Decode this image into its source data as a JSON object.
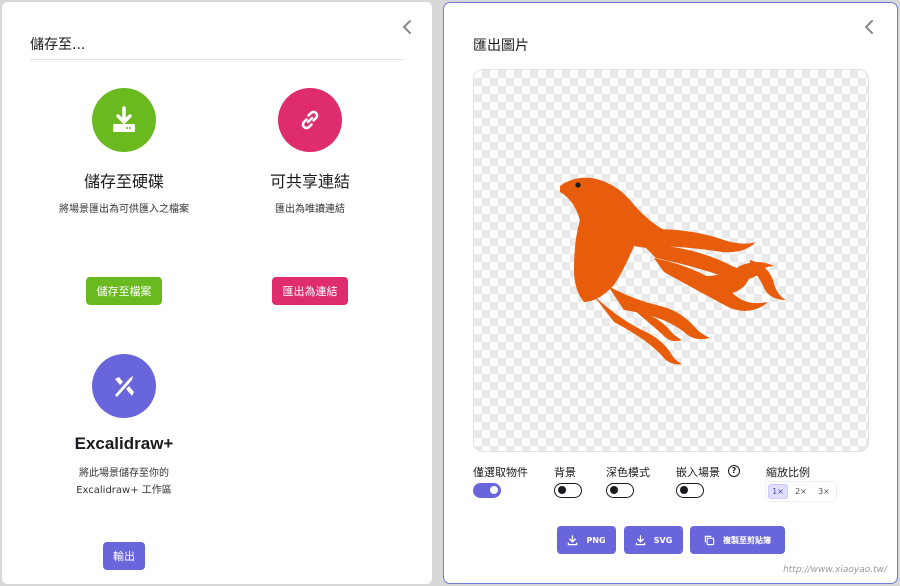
{
  "save_panel": {
    "title": "儲存至...",
    "disk": {
      "title": "儲存至硬碟",
      "description": "將場景匯出為可供匯入之檔案",
      "button": "儲存至檔案",
      "color": "#6aba1f"
    },
    "link": {
      "title": "可共享連結",
      "description": "匯出為唯讀連結",
      "button": "匯出為連結",
      "color": "#de2c6e"
    },
    "excalidraw_plus": {
      "title": "Excalidraw+",
      "description_line1": "將此場景儲存至你的",
      "description_line2": "Excalidraw+ 工作區",
      "button": "輸出",
      "color": "#6965db"
    }
  },
  "export_panel": {
    "title": "匯出圖片",
    "options": {
      "only_selected": {
        "label": "僅選取物件",
        "on": true
      },
      "background": {
        "label": "背景",
        "on": false
      },
      "dark_mode": {
        "label": "深色模式",
        "on": false
      },
      "embed_scene": {
        "label": "嵌入場景",
        "on": false,
        "help": "?"
      },
      "scale": {
        "label": "縮放比例",
        "values": [
          "1×",
          "2×",
          "3×"
        ],
        "selected": "1×"
      }
    },
    "buttons": {
      "png": "PNG",
      "svg": "SVG",
      "clipboard": "複製至剪貼簿"
    },
    "accent": "#6965db",
    "bird_color": "#e85d0c"
  },
  "watermark": "http://www.xiaoyao.tw/"
}
